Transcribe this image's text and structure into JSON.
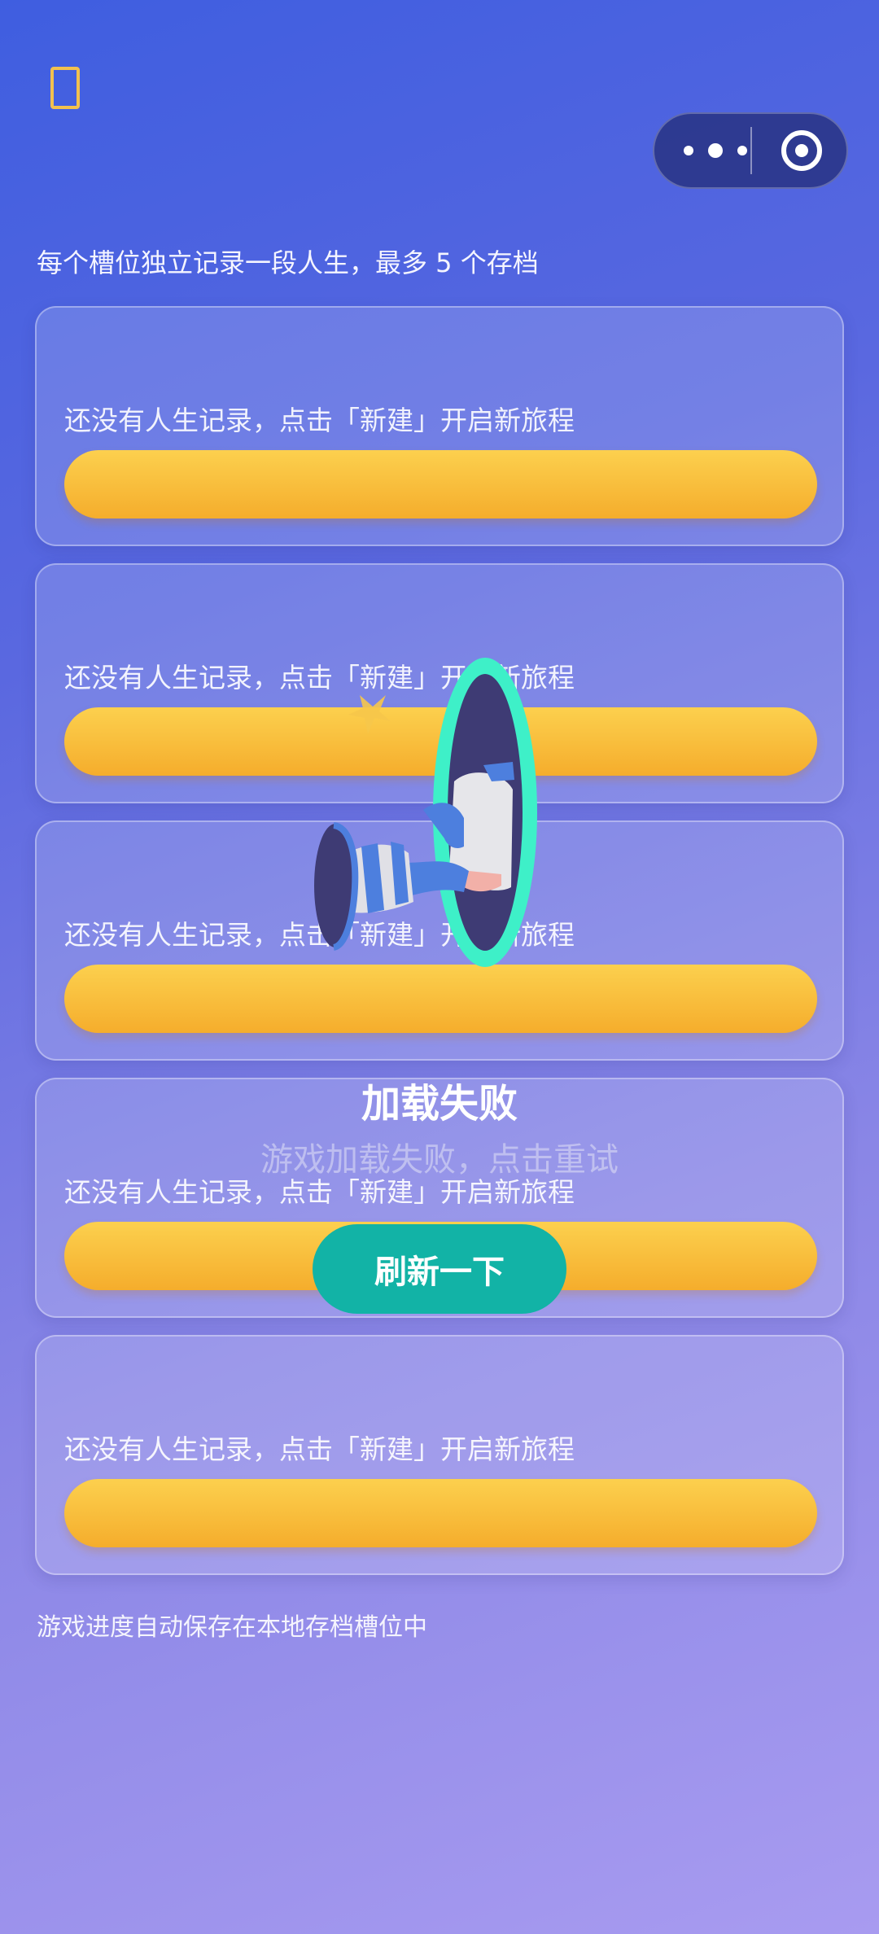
{
  "header": {
    "back_icon": "back-icon",
    "capsule": {
      "more_icon": "more-dots-icon",
      "close_icon": "target-circle-icon"
    }
  },
  "intro_text": "每个槽位独立记录一段人生，最多 5 个存档",
  "slots": [
    {
      "empty_text": "还没有人生记录，点击「新建」开启新旅程"
    },
    {
      "empty_text": "还没有人生记录，点击「新建」开启新旅程"
    },
    {
      "empty_text": "还没有人生记录，点击「新建」开启新旅程"
    },
    {
      "empty_text": "还没有人生记录，点击「新建」开启新旅程"
    },
    {
      "empty_text": "还没有人生记录，点击「新建」开启新旅程"
    }
  ],
  "footer_note": "游戏进度自动保存在本地存档槽位中",
  "error_overlay": {
    "title": "加载失败",
    "description": "游戏加载失败，点击重试",
    "refresh_label": "刷新一下",
    "illustration_icon": "portal-legs-illustration"
  },
  "colors": {
    "accent_yellow": "#f5ad2c",
    "refresh_teal": "#12b3a6",
    "portal_green": "#3ef0c8"
  }
}
